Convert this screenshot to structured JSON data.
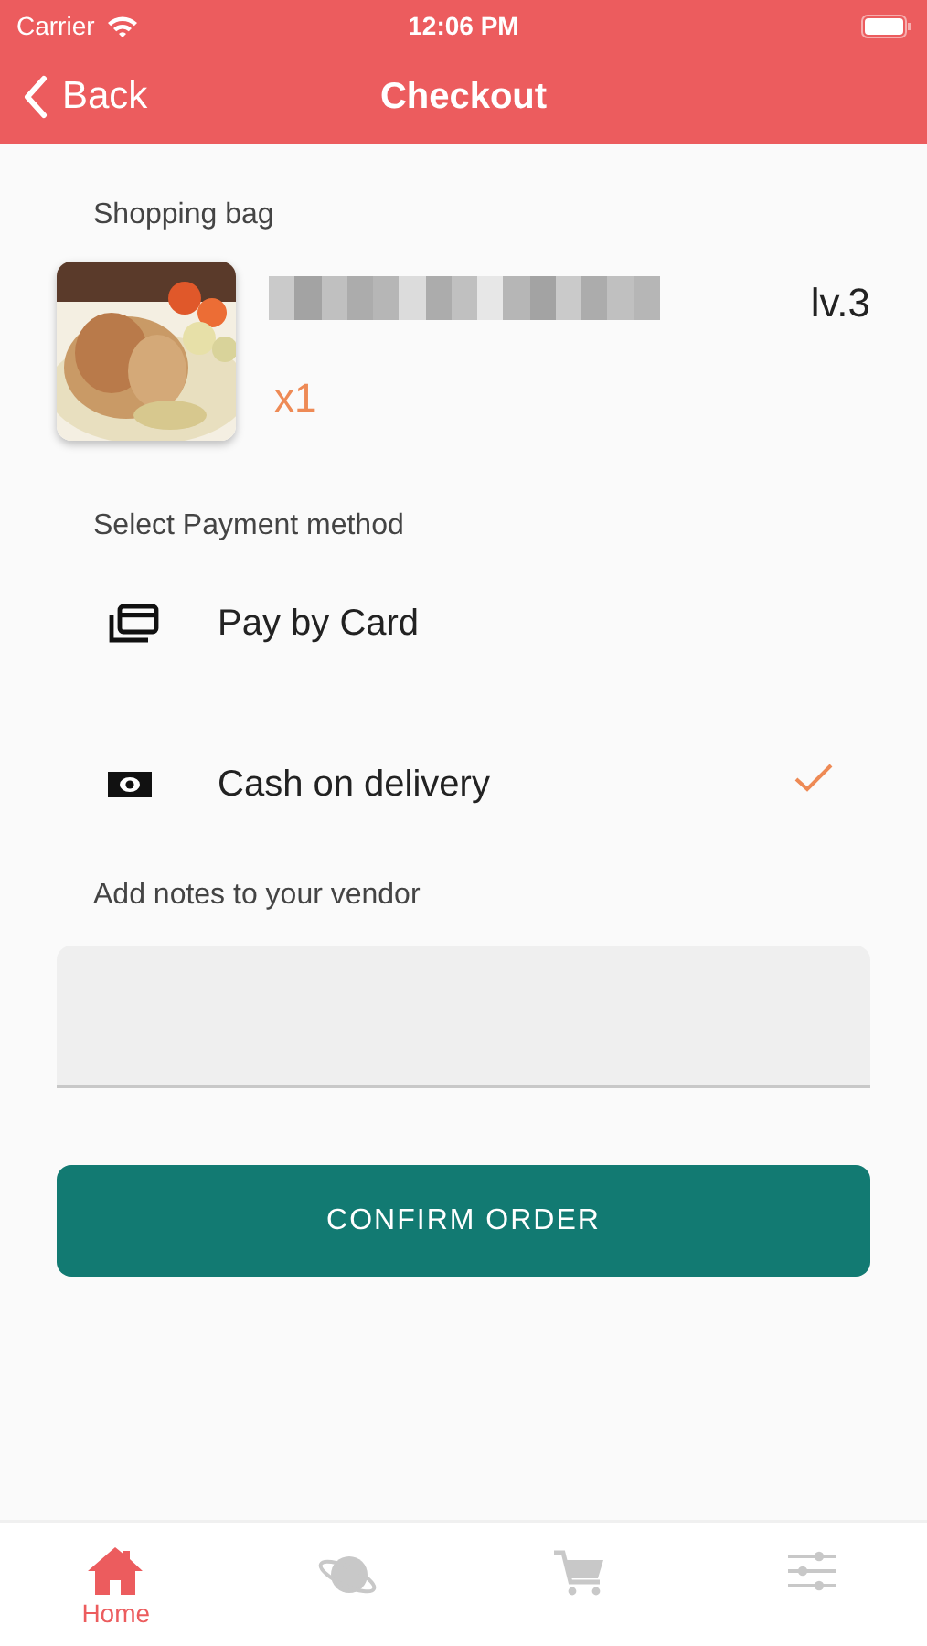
{
  "status_bar": {
    "carrier": "Carrier",
    "time": "12:06 PM"
  },
  "nav": {
    "back": "Back",
    "title": "Checkout"
  },
  "bag": {
    "heading": "Shopping bag",
    "items": [
      {
        "kind": "picture",
        "quantity": "x1",
        "level": "lv.3"
      }
    ]
  },
  "payment": {
    "heading": "Select Payment method",
    "methods": [
      {
        "kind": "card",
        "label": "Pay by Card",
        "selected": false
      },
      {
        "kind": "cash",
        "label": "Cash on delivery",
        "selected": true
      }
    ]
  },
  "notes": {
    "heading": "Add notes to your vendor"
  },
  "confirm_button": "CONFIRM ORDER",
  "tabs": [
    {
      "kind": "home",
      "label": "Home",
      "selected": true
    },
    {
      "kind": "planet",
      "selected": false
    },
    {
      "kind": "cart",
      "selected": false
    },
    {
      "kind": "sliders",
      "selected": false
    }
  ]
}
